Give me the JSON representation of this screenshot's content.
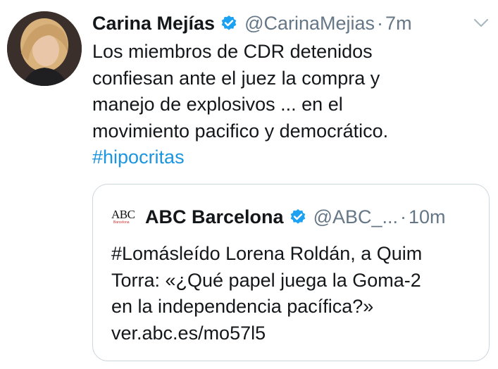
{
  "tweet": {
    "author_name": "Carina Mejías",
    "handle": "@CarinaMejias",
    "separator": "·",
    "time": "7m",
    "text_lines": [
      "Los miembros de CDR detenidos",
      "confiesan ante el juez la compra y",
      "manejo de explosivos ... en el",
      "movimiento pacifico y democrático."
    ],
    "hashtag": "#hipocritas"
  },
  "quoted_tweet": {
    "logo_text": "ABC",
    "logo_subtext": "Barcelona",
    "author_name": "ABC Barcelona",
    "handle": "@ABC_...",
    "separator": "·",
    "time": "10m",
    "text_lines": [
      "#Lomásleído Lorena Roldán, a Quim",
      "Torra: «¿Qué papel juega la Goma-2",
      "en la independencia pacífica?»",
      "ver.abc.es/mo57l5"
    ]
  },
  "icons": {
    "avatar": "profile-photo",
    "verified": "verified-badge-icon",
    "menu": "chevron-down-icon"
  },
  "colors": {
    "text": "#14171a",
    "secondary": "#657786",
    "link": "#1b95e0",
    "verified": "#1da1f2",
    "border": "#ccd6dd"
  }
}
